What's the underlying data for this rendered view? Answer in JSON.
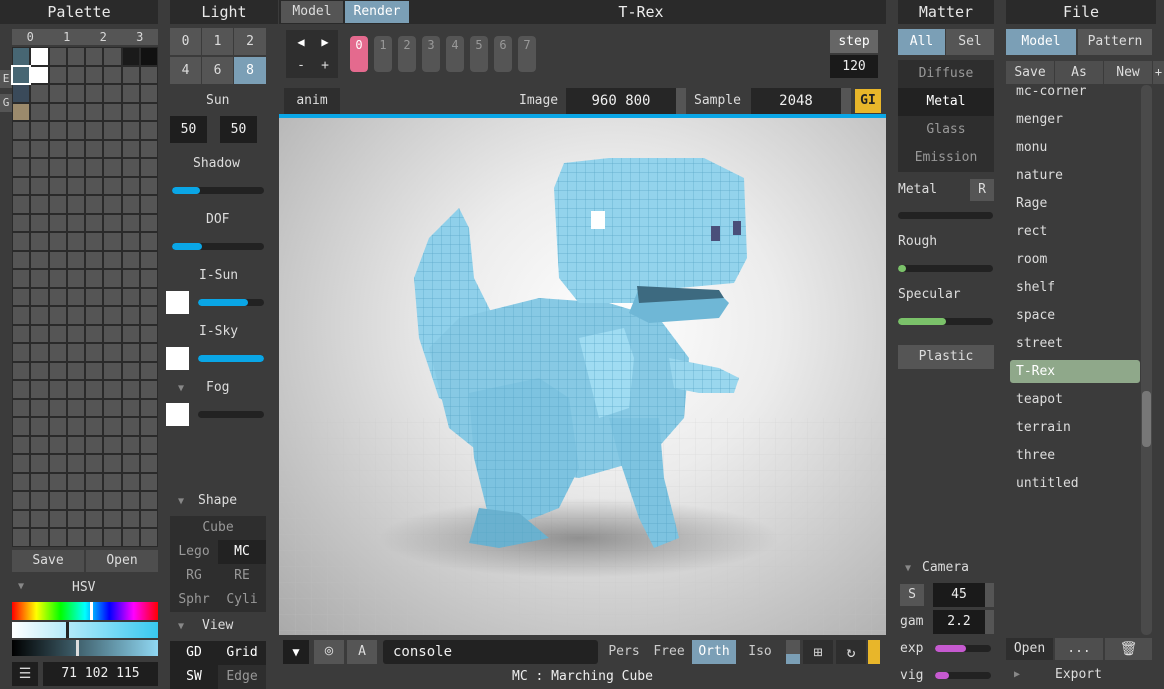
{
  "palette": {
    "title": "Palette",
    "cols": [
      "0",
      "1",
      "2",
      "3"
    ],
    "side_e": "E",
    "side_g": "G",
    "save": "Save",
    "open": "Open",
    "hsv": "HSV",
    "rgb_value": "71 102 115",
    "colors": {
      "sel": "#476673",
      "white": "#ffffff",
      "tan": "#9b8a6c",
      "black": "#111111",
      "dk": "#1a1a1a",
      "cell": "#555555"
    }
  },
  "light": {
    "title": "Light",
    "nums_row1": [
      "0",
      "1",
      "2"
    ],
    "nums_row2": [
      "4",
      "6",
      "8"
    ],
    "active": "8",
    "sun": "Sun",
    "sun_a": "50",
    "sun_b": "50",
    "shadow": "Shadow",
    "shadow_val": 0.3,
    "dof": "DOF",
    "dof_val": 0.33,
    "isun": "I-Sun",
    "isun_val": 0.75,
    "isky": "I-Sky",
    "isky_val": 1.0,
    "fog": "Fog",
    "fog_val": 0.0,
    "shape": "Shape",
    "shapes": [
      "Cube",
      "Lego",
      "MC",
      "RG",
      "RE",
      "Sphr",
      "Cyli"
    ],
    "shape_active": "MC",
    "view": "View",
    "view_items": [
      "GD",
      "Grid",
      "SW",
      "Edge"
    ]
  },
  "top": {
    "model_tab": "Model",
    "render_tab": "Render",
    "title": "T-Rex",
    "frames": [
      "0",
      "1",
      "2",
      "3",
      "4",
      "5",
      "6",
      "7"
    ],
    "step": "step",
    "step_val": "120",
    "minus": "-",
    "plus": "+",
    "anim": "anim",
    "image_lbl": "Image",
    "image_val": "960 800",
    "sample_lbl": "Sample",
    "sample_val": "2048",
    "gi": "GI"
  },
  "bottom": {
    "a": "A",
    "console": "console",
    "modes": [
      "Pers",
      "Free",
      "Orth",
      "Iso"
    ],
    "mode_active": "Orth",
    "status": "MC : Marching Cube"
  },
  "matter": {
    "title": "Matter",
    "all": "All",
    "sel": "Sel",
    "types": [
      "Diffuse",
      "Metal",
      "Glass",
      "Emission"
    ],
    "type_active": "Metal",
    "metal": "Metal",
    "r": "R",
    "metal_val": 0.0,
    "rough": "Rough",
    "rough_val": 0.08,
    "specular": "Specular",
    "specular_val": 0.5,
    "plastic": "Plastic",
    "camera": "Camera",
    "s": "S",
    "fov": "45",
    "gam": "gam",
    "gam_val": "2.2",
    "exp": "exp",
    "exp_val": 0.55,
    "vig": "vig",
    "vig_val": 0.25
  },
  "file": {
    "title": "File",
    "model": "Model",
    "pattern": "Pattern",
    "save": "Save",
    "as": "As",
    "new": "New",
    "plus": "+",
    "items": [
      "mc-corner",
      "menger",
      "monu",
      "nature",
      "Rage",
      "rect",
      "room",
      "shelf",
      "space",
      "street",
      "T-Rex",
      "teapot",
      "terrain",
      "three",
      "untitled"
    ],
    "selected": "T-Rex",
    "open": "Open",
    "dots": "...",
    "export": "Export"
  },
  "colors": {
    "accent_blue": "#0aa6e6",
    "active_tab": "#7b9fb6",
    "pink": "#e46a8e",
    "gold": "#e8b62a",
    "green": "#7bc26a",
    "magenta": "#c65ad0",
    "list_sel": "#8fa88a",
    "model": "#8fd0ea"
  }
}
